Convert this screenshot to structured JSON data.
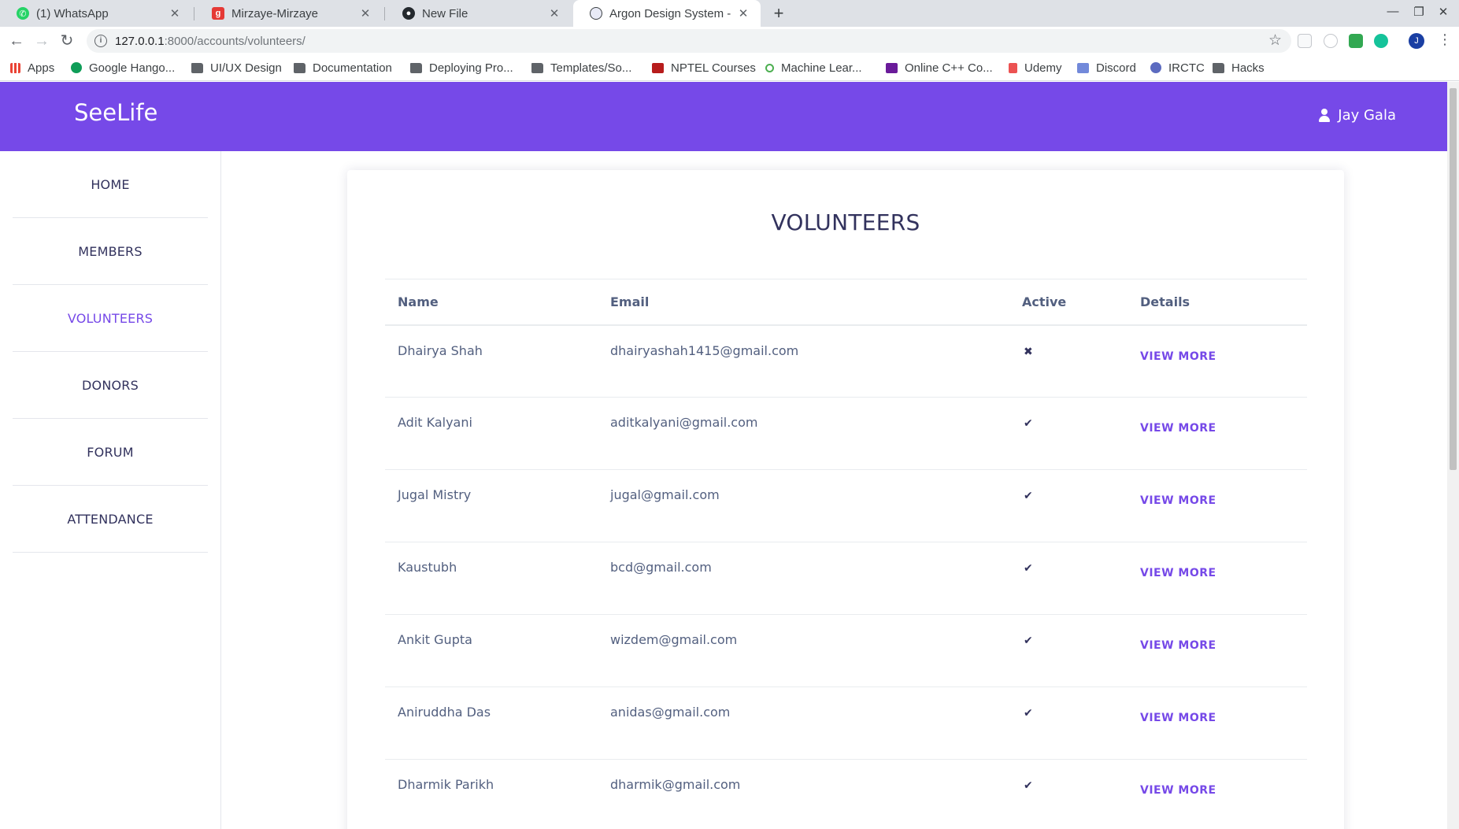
{
  "browser": {
    "tabs": [
      {
        "title": "(1) WhatsApp",
        "favicon": "whatsapp-icon",
        "color": "#25d366"
      },
      {
        "title": "Mirzaye-Mirzaye",
        "favicon": "mirzaye-icon",
        "color": "#e53935"
      },
      {
        "title": "New File",
        "favicon": "github-icon",
        "color": "#24292e"
      },
      {
        "title": "Argon Design System - Fr",
        "favicon": "argon-icon",
        "color": "#5e72e4"
      }
    ],
    "url_host": "127.0.0.1",
    "url_path": ":8000/accounts/volunteers/",
    "profile_initial": "J",
    "bookmarks": [
      {
        "label": "Apps",
        "icon": "apps-grid-icon"
      },
      {
        "label": "Google Hango...",
        "icon": "hangouts-icon"
      },
      {
        "label": "UI/UX Design",
        "icon": "folder-icon"
      },
      {
        "label": "Documentation",
        "icon": "folder-icon"
      },
      {
        "label": "Deploying Pro...",
        "icon": "folder-icon"
      },
      {
        "label": "Templates/So...",
        "icon": "folder-icon"
      },
      {
        "label": "NPTEL Courses",
        "icon": "nptel-icon"
      },
      {
        "label": "Machine Lear...",
        "icon": "code-icon"
      },
      {
        "label": "Online C++ Co...",
        "icon": "bolt-icon"
      },
      {
        "label": "Udemy",
        "icon": "udemy-icon"
      },
      {
        "label": "Discord",
        "icon": "discord-icon"
      },
      {
        "label": "IRCTC",
        "icon": "irctc-icon"
      },
      {
        "label": "Hacks",
        "icon": "folder-icon"
      }
    ]
  },
  "app": {
    "brand": "SeeLife",
    "user_name": "Jay Gala",
    "accent_color": "#7649e8",
    "sidebar": [
      {
        "label": "HOME",
        "active": false
      },
      {
        "label": "MEMBERS",
        "active": false
      },
      {
        "label": "VOLUNTEERS",
        "active": true
      },
      {
        "label": "DONORS",
        "active": false
      },
      {
        "label": "FORUM",
        "active": false
      },
      {
        "label": "ATTENDANCE",
        "active": false
      }
    ],
    "page_title": "VOLUNTEERS",
    "table": {
      "headers": [
        "Name",
        "Email",
        "Active",
        "Details"
      ],
      "rows": [
        {
          "name": "Dhairya Shah",
          "email": "dhairyashah1415@gmail.com",
          "active": false,
          "details": "VIEW MORE"
        },
        {
          "name": "Adit Kalyani",
          "email": "aditkalyani@gmail.com",
          "active": true,
          "details": "VIEW MORE"
        },
        {
          "name": "Jugal Mistry",
          "email": "jugal@gmail.com",
          "active": true,
          "details": "VIEW MORE"
        },
        {
          "name": "Kaustubh",
          "email": "bcd@gmail.com",
          "active": true,
          "details": "VIEW MORE"
        },
        {
          "name": "Ankit Gupta",
          "email": "wizdem@gmail.com",
          "active": true,
          "details": "VIEW MORE"
        },
        {
          "name": "Aniruddha Das",
          "email": "anidas@gmail.com",
          "active": true,
          "details": "VIEW MORE"
        },
        {
          "name": "Dharmik Parikh",
          "email": "dharmik@gmail.com",
          "active": true,
          "details": "VIEW MORE"
        }
      ]
    }
  }
}
